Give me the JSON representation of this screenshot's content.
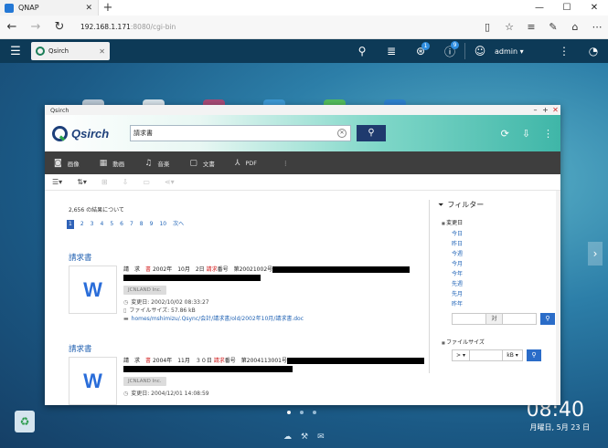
{
  "browser": {
    "tab_title": "QNAP",
    "tab_close": "✕",
    "new_tab": "+",
    "win_min": "—",
    "win_max": "☐",
    "win_close": "✕",
    "url_host": "192.168.1.171",
    "url_rest": ":8080/cgi-bin"
  },
  "qts": {
    "app_tab": "Qsirch",
    "user": "admin ▾",
    "badge_1": "1",
    "badge_2": "9"
  },
  "app": {
    "window_title": "Qsirch",
    "logo_text": "Qsirch",
    "search_value": "請求書",
    "file_tabs": [
      {
        "icon": "camera-icon",
        "label": "画像"
      },
      {
        "icon": "film-icon",
        "label": "動画"
      },
      {
        "icon": "music-icon",
        "label": "音楽"
      },
      {
        "icon": "document-icon",
        "label": "文書"
      },
      {
        "icon": "pdf-icon",
        "label": "PDF"
      }
    ],
    "more": "⋮",
    "result_count": "2,656 の結果について",
    "pages": [
      "1",
      "2",
      "3",
      "4",
      "5",
      "6",
      "7",
      "8",
      "9",
      "10",
      "次へ"
    ],
    "results": [
      {
        "title": "請求書",
        "line1": [
          "請　求　",
          "書",
          " 2002年　10月　2日 ",
          "請求",
          "番号　第20021002号"
        ],
        "tag": "JCNLAND Inc.",
        "modified": "変更日: 2002/10/02 08:33:27",
        "size": "ファイルサイズ: 57.86 kB",
        "path": "homes/mshimizu/.Qsync/会計/請求書/old/2002年10月/請求書.doc"
      },
      {
        "title": "請求書",
        "line1": [
          "請　求　",
          "書",
          " 2004年　11月　３０日 ",
          "請求",
          "番号　第2004113001号"
        ],
        "tag": "JCNLAND Inc.",
        "modified": "変更日: 2004/12/01 14:08:59"
      }
    ],
    "filter": {
      "title": "フィルター",
      "modified_group": "変更日",
      "modified_opts": [
        "今日",
        "昨日",
        "今週",
        "今月",
        "今年",
        "先週",
        "先月",
        "昨年"
      ],
      "range_mid": "対",
      "size_group": "ファイルサイズ",
      "size_op": "> ▾",
      "size_unit": "kB ▾"
    }
  },
  "desktop": {
    "time": "08:40",
    "date": "月曜日, 5月 23 日"
  }
}
